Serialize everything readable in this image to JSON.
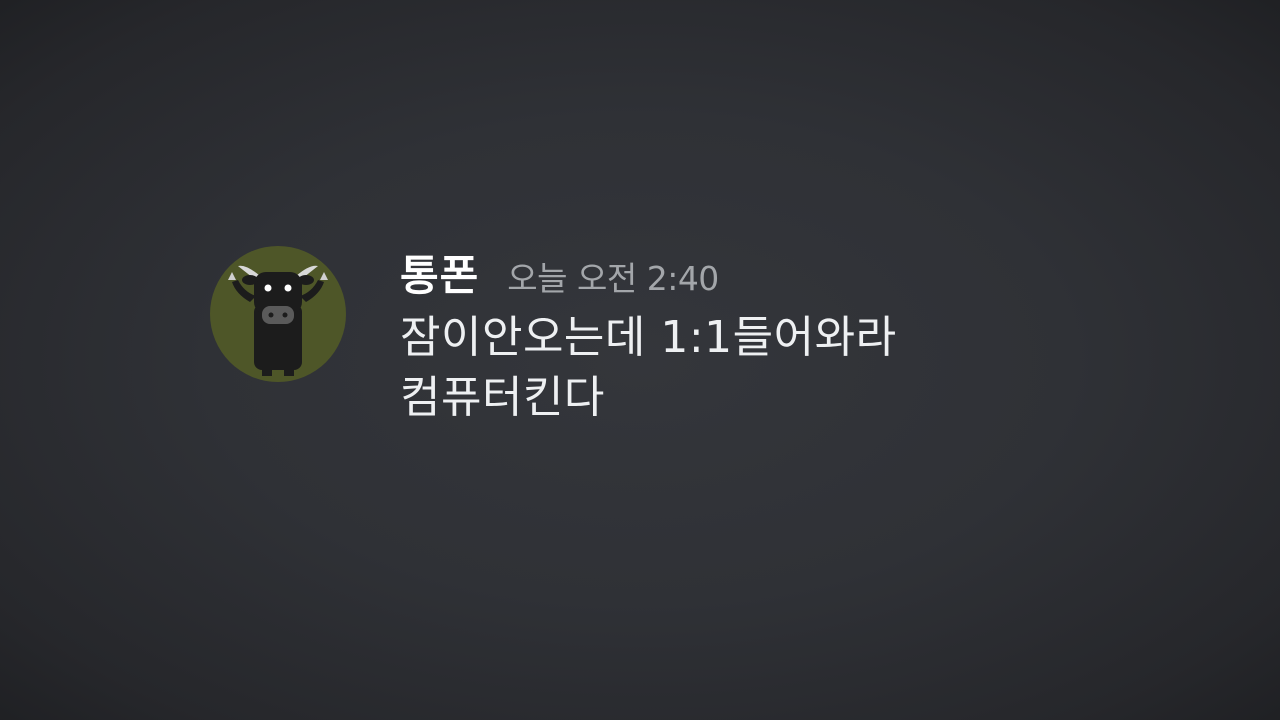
{
  "message": {
    "author": "통폰",
    "timestamp": "오늘 오전 2:40",
    "lines": [
      "잠이안오는데 1:1들어와라",
      "컴퓨터킨다"
    ],
    "avatar": {
      "icon": "cow-avatar-icon",
      "background_color": "#4e5628"
    }
  }
}
